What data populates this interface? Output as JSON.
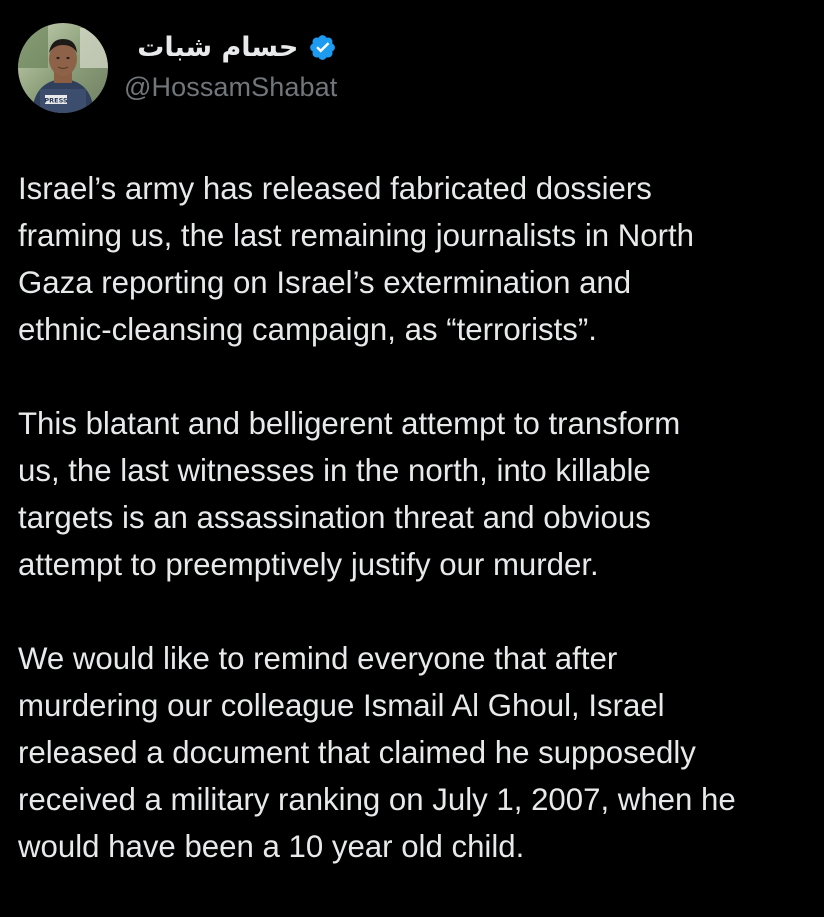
{
  "author": {
    "display_name": "حسام شبات",
    "handle": "@HossamShabat",
    "verified": true,
    "avatar_badge_text": "PRESS"
  },
  "colors": {
    "background": "#000000",
    "text": "#e7e9ea",
    "secondary_text": "#71767b",
    "verified_badge": "#1d9bf0"
  },
  "icons": {
    "verified": "verified-badge-icon"
  },
  "tweet": {
    "paragraphs": [
      {
        "lines": [
          "Israel’s army has released fabricated dossiers",
          "framing us, the last remaining journalists in North",
          "Gaza reporting on Israel’s extermination and",
          "ethnic-cleansing campaign, as “terrorists”."
        ]
      },
      {
        "lines": [
          "This blatant and belligerent attempt to transform",
          "us, the last witnesses in the north, into killable",
          "targets is an assassination threat and obvious",
          "attempt to preemptively justify our murder."
        ]
      },
      {
        "lines": [
          "We would like to remind everyone that after",
          "murdering our colleague Ismail Al Ghoul, Israel",
          "released a document that claimed he supposedly",
          "received a military ranking on July 1, 2007, when he",
          "would have been a 10 year old child."
        ]
      }
    ]
  }
}
